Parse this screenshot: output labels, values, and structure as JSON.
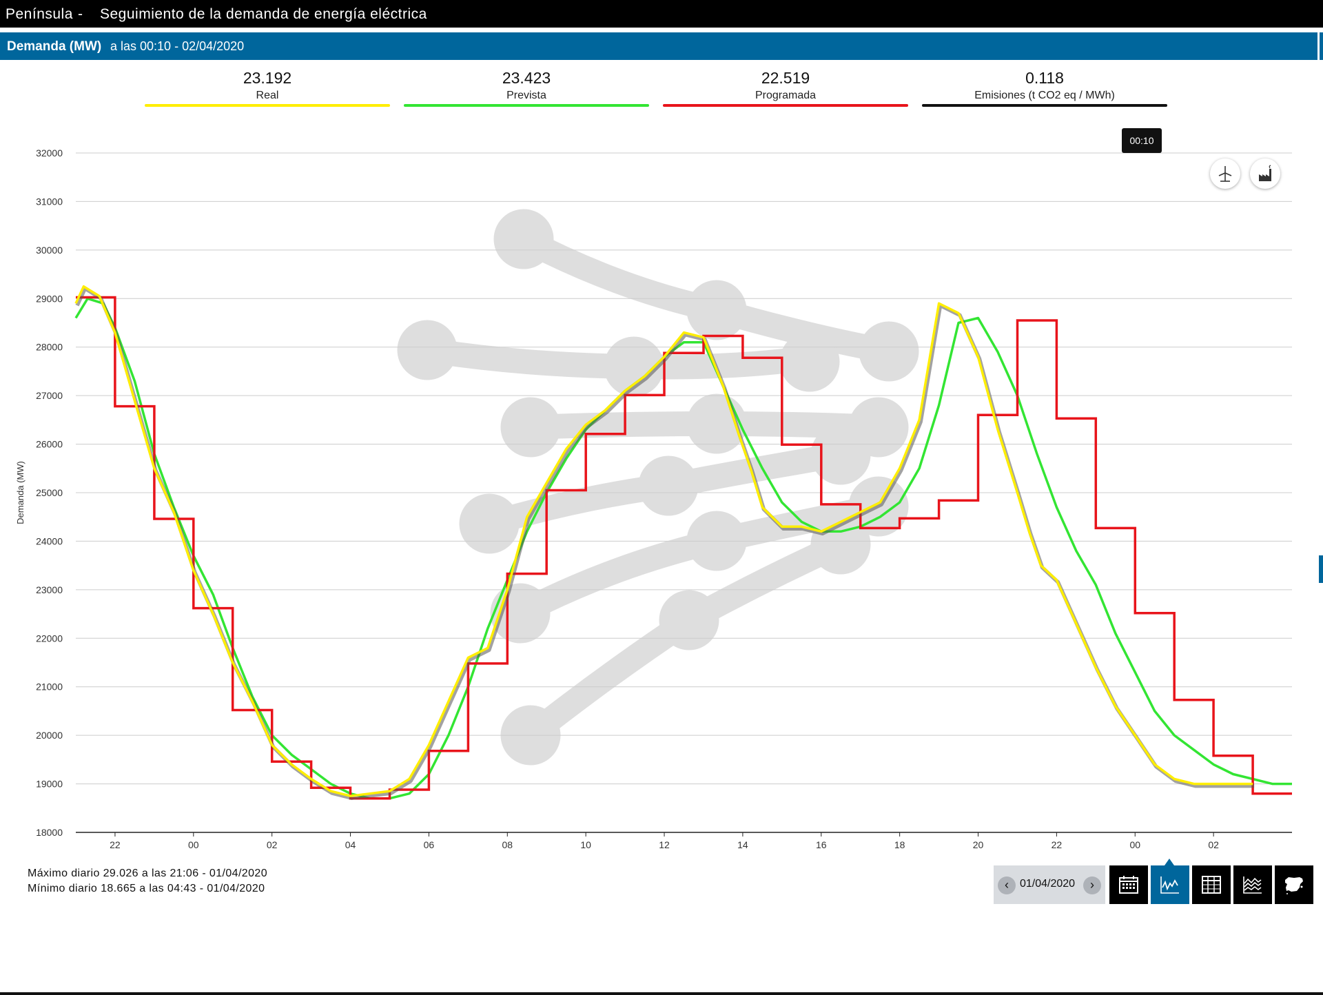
{
  "header": {
    "region": "Península",
    "separator": "-",
    "title": "Seguimiento de la demanda de energía eléctrica"
  },
  "subheader": {
    "label": "Demanda (MW)",
    "time_text": "a las 00:10 - 02/04/2020"
  },
  "kpis": [
    {
      "value": "23.192",
      "label": "Real",
      "color": "#ffee00"
    },
    {
      "value": "23.423",
      "label": "Prevista",
      "color": "#33e533"
    },
    {
      "value": "22.519",
      "label": "Programada",
      "color": "#e8141b"
    },
    {
      "value": "0.118",
      "label": "Emisiones (t CO2 eq / MWh)",
      "color": "#111111"
    }
  ],
  "tooltip": "00:10",
  "side_buttons": [
    {
      "icon": "wind-turbine-icon"
    },
    {
      "icon": "factory-icon"
    }
  ],
  "chart_data": {
    "type": "line",
    "ylabel": "Demanda (MW)",
    "ylim": [
      18000,
      32000
    ],
    "y_ticks": [
      "32000",
      "31000",
      "30000",
      "29000",
      "28000",
      "27000",
      "26000",
      "25000",
      "24000",
      "23000",
      "22000",
      "21000",
      "20000",
      "19000",
      "18000"
    ],
    "x_ticks": [
      "22",
      "00",
      "02",
      "04",
      "06",
      "08",
      "10",
      "12",
      "14",
      "16",
      "18",
      "20",
      "22",
      "00",
      "02"
    ],
    "x_ticks_hours": [
      22,
      24,
      26,
      28,
      30,
      32,
      34,
      36,
      38,
      40,
      42,
      44,
      46,
      48,
      50
    ],
    "xlim": [
      21.0,
      52.0
    ],
    "grid": true,
    "series": [
      {
        "name": "Real",
        "color": "#ffee00",
        "style": "line",
        "x": [
          21.0,
          21.2,
          21.6,
          22.0,
          22.5,
          23.0,
          23.5,
          24.0,
          24.5,
          25.0,
          25.5,
          26.0,
          26.5,
          27.0,
          27.5,
          28.0,
          28.5,
          29.0,
          29.5,
          30.0,
          30.5,
          31.0,
          31.5,
          32.0,
          32.5,
          33.0,
          33.5,
          34.0,
          34.5,
          35.0,
          35.5,
          36.0,
          36.5,
          37.0,
          37.5,
          37.9,
          38.2,
          38.5,
          39.0,
          39.5,
          40.0,
          40.5,
          41.0,
          41.5,
          42.0,
          42.5,
          43.0,
          43.5,
          44.0,
          44.5,
          45.0,
          45.3,
          45.6,
          46.0,
          46.5,
          47.0,
          47.5,
          48.0,
          48.5,
          49.0,
          49.5,
          50.0,
          50.5,
          51.0
        ],
        "y": [
          28900,
          29250,
          29050,
          28300,
          26900,
          25500,
          24600,
          23400,
          22500,
          21500,
          20700,
          19800,
          19400,
          19100,
          18850,
          18750,
          18800,
          18850,
          19100,
          19800,
          20700,
          21600,
          21800,
          23000,
          24500,
          25200,
          25900,
          26400,
          26700,
          27100,
          27400,
          27800,
          28300,
          28200,
          27200,
          26200,
          25500,
          24700,
          24300,
          24300,
          24200,
          24400,
          24600,
          24800,
          25500,
          26500,
          28900,
          28700,
          27800,
          26300,
          25000,
          24200,
          23500,
          23200,
          22300,
          21400,
          20600,
          20000,
          19400,
          19100,
          19000,
          19000,
          19000,
          19000
        ],
        "x_end": 51.0
      },
      {
        "name": "Prevista",
        "color": "#33e533",
        "style": "line",
        "x": [
          21.0,
          21.3,
          21.7,
          22.0,
          22.5,
          23.0,
          23.5,
          24.0,
          24.5,
          25.0,
          25.5,
          26.0,
          26.5,
          27.0,
          27.5,
          28.0,
          28.5,
          29.0,
          29.5,
          30.0,
          30.5,
          31.0,
          31.5,
          32.0,
          32.5,
          33.0,
          33.5,
          34.0,
          34.5,
          35.0,
          35.5,
          36.0,
          36.5,
          37.0,
          37.5,
          38.0,
          38.5,
          39.0,
          39.5,
          40.0,
          40.5,
          41.0,
          41.5,
          42.0,
          42.5,
          43.0,
          43.5,
          44.0,
          44.5,
          45.0,
          45.5,
          46.0,
          46.5,
          47.0,
          47.5,
          48.0,
          48.5,
          49.0,
          49.5,
          50.0,
          50.5,
          51.0,
          51.5,
          52.0
        ],
        "y": [
          28600,
          29000,
          28900,
          28400,
          27300,
          25800,
          24700,
          23700,
          22900,
          21800,
          20800,
          20000,
          19600,
          19300,
          19000,
          18800,
          18700,
          18700,
          18800,
          19200,
          20000,
          21000,
          22200,
          23200,
          24200,
          25000,
          25700,
          26300,
          26700,
          27100,
          27400,
          27800,
          28100,
          28100,
          27200,
          26300,
          25500,
          24800,
          24400,
          24200,
          24200,
          24300,
          24500,
          24800,
          25500,
          26800,
          28500,
          28600,
          27900,
          27000,
          25800,
          24700,
          23800,
          23100,
          22100,
          21300,
          20500,
          20000,
          19700,
          19400,
          19200,
          19100,
          19000,
          19000
        ]
      },
      {
        "name": "Programada",
        "color": "#e8141b",
        "style": "step",
        "steps": [
          [
            21.0,
            29026
          ],
          [
            22.0,
            26780
          ],
          [
            23.0,
            24460
          ],
          [
            24.0,
            22620
          ],
          [
            25.0,
            20520
          ],
          [
            26.0,
            19460
          ],
          [
            27.0,
            18920
          ],
          [
            28.0,
            18700
          ],
          [
            29.0,
            18880
          ],
          [
            30.0,
            19680
          ],
          [
            31.0,
            21480
          ],
          [
            32.0,
            23330
          ],
          [
            33.0,
            25050
          ],
          [
            34.0,
            26210
          ],
          [
            35.0,
            27010
          ],
          [
            36.0,
            27880
          ],
          [
            37.0,
            28230
          ],
          [
            38.0,
            27780
          ],
          [
            39.0,
            25990
          ],
          [
            40.0,
            24760
          ],
          [
            41.0,
            24270
          ],
          [
            42.0,
            24470
          ],
          [
            43.0,
            24840
          ],
          [
            44.0,
            26600
          ],
          [
            45.0,
            28550
          ],
          [
            46.0,
            26530
          ],
          [
            47.0,
            24270
          ],
          [
            48.0,
            22520
          ],
          [
            49.0,
            20730
          ],
          [
            50.0,
            19580
          ],
          [
            51.0,
            18800
          ]
        ],
        "x_end": 52.0
      }
    ]
  },
  "footer": {
    "max_text": "Máximo diario 29.026 a las 21:06 - 01/04/2020",
    "min_text": "Mínimo diario 18.665 a las 04:43 - 01/04/2020"
  },
  "toolbar": {
    "date": "01/04/2020",
    "prev": "‹",
    "next": "›",
    "buttons": [
      {
        "icon": "calendar-icon",
        "active": false
      },
      {
        "icon": "line-chart-icon",
        "active": true
      },
      {
        "icon": "table-icon",
        "active": false
      },
      {
        "icon": "area-chart-icon",
        "active": false
      },
      {
        "icon": "spain-map-icon",
        "active": false
      }
    ]
  }
}
